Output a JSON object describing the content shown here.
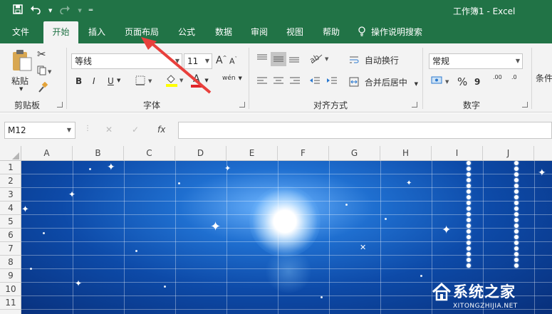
{
  "app": {
    "document_title": "工作簿1  -  Excel",
    "accent": "#217346"
  },
  "qat": {
    "save_icon": "save-icon",
    "undo_icon": "undo-icon",
    "redo_icon": "redo-icon",
    "customize_icon": "chevron-down-icon"
  },
  "tabs": [
    {
      "label": "文件",
      "active": false
    },
    {
      "label": "开始",
      "active": true
    },
    {
      "label": "插入",
      "active": false
    },
    {
      "label": "页面布局",
      "active": false
    },
    {
      "label": "公式",
      "active": false
    },
    {
      "label": "数据",
      "active": false
    },
    {
      "label": "审阅",
      "active": false
    },
    {
      "label": "视图",
      "active": false
    },
    {
      "label": "帮助",
      "active": false
    }
  ],
  "tell_me": {
    "label": "操作说明搜索",
    "icon": "lightbulb-icon"
  },
  "ribbon": {
    "clipboard": {
      "paste_label": "粘贴",
      "group_label": "剪贴板"
    },
    "font": {
      "font_name": "等线",
      "font_size": "11",
      "grow_label": "A",
      "shrink_label": "A",
      "bold": "B",
      "italic": "I",
      "underline": "U",
      "font_color_label": "A",
      "phonetic_label": "wén",
      "group_label": "字体",
      "font_color": "#e0252a",
      "fill_color": "#ffff00"
    },
    "alignment": {
      "wrap_text": "自动换行",
      "merge_center": "合并后居中",
      "group_label": "对齐方式"
    },
    "number": {
      "format": "常规",
      "percent": "%",
      "comma": "9",
      "inc_decimal": ".00",
      "dec_decimal": ".0",
      "group_label": "数字"
    },
    "styles": {
      "conditional": "条件"
    }
  },
  "formula_bar": {
    "name_box": "M12",
    "cancel": "✕",
    "enter": "✓",
    "fx": "fx",
    "formula": ""
  },
  "columns": [
    "A",
    "B",
    "C",
    "D",
    "E",
    "F",
    "G",
    "H",
    "I",
    "J"
  ],
  "rows": [
    "1",
    "2",
    "3",
    "4",
    "5",
    "6",
    "7",
    "8",
    "9",
    "10",
    "11"
  ],
  "watermark": {
    "brand": "系统之家",
    "url": "XITONGZHIJIA.NET"
  }
}
